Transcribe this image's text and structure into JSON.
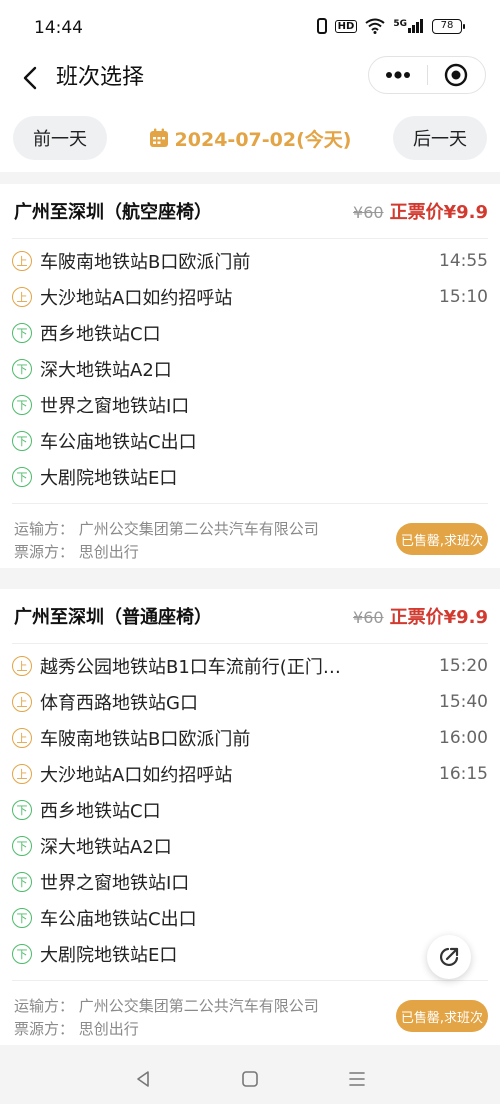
{
  "status_bar": {
    "time": "14:44",
    "hd_label": "HD",
    "network_label": "5G",
    "battery": "78"
  },
  "header": {
    "title": "班次选择"
  },
  "date_bar": {
    "prev_label": "前一天",
    "date_label": "2024-07-02(今天)",
    "next_label": "后一天"
  },
  "routes": [
    {
      "title": "广州至深圳（航空座椅）",
      "original_price": "¥60",
      "current_price": "正票价¥9.9",
      "stops": [
        {
          "type": "上",
          "name": "车陂南地铁站B口欧派门前",
          "time": "14:55"
        },
        {
          "type": "上",
          "name": "大沙地站A口如约招呼站",
          "time": "15:10"
        },
        {
          "type": "下",
          "name": "西乡地铁站C口",
          "time": ""
        },
        {
          "type": "下",
          "name": "深大地铁站A2口",
          "time": ""
        },
        {
          "type": "下",
          "name": "世界之窗地铁站I口",
          "time": ""
        },
        {
          "type": "下",
          "name": "车公庙地铁站C出口",
          "time": ""
        },
        {
          "type": "下",
          "name": "大剧院地铁站E口",
          "time": ""
        }
      ],
      "carrier": "运输方：  广州公交集团第二公共汽车有限公司",
      "ticket_source": "票源方：  思创出行",
      "action_label": "已售罄,求班次"
    },
    {
      "title": "广州至深圳（普通座椅）",
      "original_price": "¥60",
      "current_price": "正票价¥9.9",
      "stops": [
        {
          "type": "上",
          "name": "越秀公园地铁站B1口车流前行(正门…",
          "time": "15:20"
        },
        {
          "type": "上",
          "name": "体育西路地铁站G口",
          "time": "15:40"
        },
        {
          "type": "上",
          "name": "车陂南地铁站B口欧派门前",
          "time": "16:00"
        },
        {
          "type": "上",
          "name": "大沙地站A口如约招呼站",
          "time": "16:15"
        },
        {
          "type": "下",
          "name": "西乡地铁站C口",
          "time": ""
        },
        {
          "type": "下",
          "name": "深大地铁站A2口",
          "time": ""
        },
        {
          "type": "下",
          "name": "世界之窗地铁站I口",
          "time": ""
        },
        {
          "type": "下",
          "name": "车公庙地铁站C出口",
          "time": ""
        },
        {
          "type": "下",
          "name": "大剧院地铁站E口",
          "time": ""
        }
      ],
      "carrier": "运输方：  广州公交集团第二公共汽车有限公司",
      "ticket_source": "票源方：  思创出行",
      "action_label": "已售罄,求班次"
    }
  ],
  "colors": {
    "accent": "#e3a445",
    "price_red": "#d23a2f",
    "alight_green": "#4dbb6a"
  },
  "icons": {
    "back": "chevron-left-icon",
    "more": "more-dots-icon",
    "close": "target-circle-icon",
    "calendar": "calendar-icon",
    "share": "share-icon",
    "nav_back": "triangle-back-icon",
    "nav_home": "square-home-icon",
    "nav_menu": "menu-lines-icon"
  }
}
